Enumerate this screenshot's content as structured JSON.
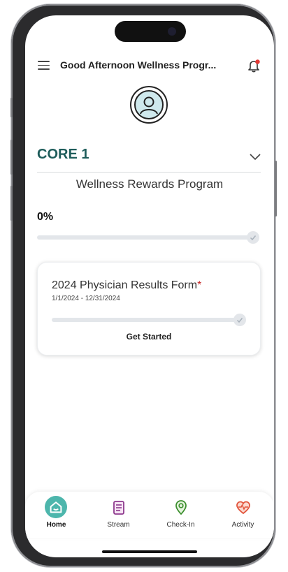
{
  "header": {
    "title": "Good Afternoon Wellness Progr..."
  },
  "core": {
    "title": "CORE 1",
    "program_name": "Wellness Rewards Program",
    "progress_label": "0%",
    "progress_fraction": 0
  },
  "card": {
    "title": "2024 Physician Results Form",
    "required_marker": "*",
    "dates": "1/1/2024 - 12/31/2024",
    "progress_fraction": 0,
    "action_label": "Get Started"
  },
  "tabs": [
    {
      "label": "Home",
      "icon": "home-icon",
      "active": true
    },
    {
      "label": "Stream",
      "icon": "stream-icon",
      "active": false
    },
    {
      "label": "Check-In",
      "icon": "location-pin-icon",
      "active": false
    },
    {
      "label": "Activity",
      "icon": "heart-pulse-icon",
      "active": false
    }
  ],
  "colors": {
    "accent": "#4db6ac",
    "core_title": "#1f5d5b",
    "required": "#c62828",
    "stream_icon": "#8e3a8e",
    "checkin_icon": "#3d8f2f",
    "activity_icon": "#e2553d",
    "notification_dot": "#e53935"
  }
}
